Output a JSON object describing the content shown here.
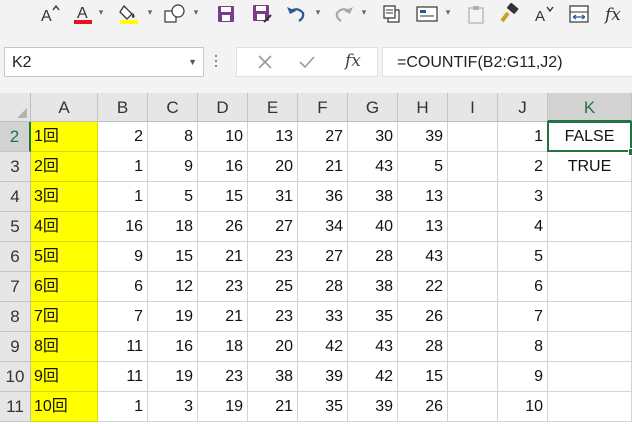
{
  "toolbar": {
    "font_color": "#e81123",
    "highlight_color": "#ffff00",
    "items": [
      {
        "name": "font-size-increase-icon"
      },
      {
        "name": "font-color-icon"
      },
      {
        "name": "fill-color-icon"
      },
      {
        "name": "shapes-icon"
      },
      {
        "name": "save-icon"
      },
      {
        "name": "save-as-icon"
      },
      {
        "name": "undo-icon"
      },
      {
        "name": "redo-icon"
      },
      {
        "name": "copy-icon"
      },
      {
        "name": "form-icon"
      },
      {
        "name": "paste-icon"
      },
      {
        "name": "format-painter-icon"
      },
      {
        "name": "font-size-decrease-icon"
      },
      {
        "name": "column-width-icon"
      },
      {
        "name": "insert-function-icon"
      }
    ]
  },
  "formula_bar": {
    "name_box": "K2",
    "fx_label": "fx",
    "formula": "=COUNTIF(B2:G11,J2)"
  },
  "grid": {
    "accent_color": "#217346",
    "highlight_fill": "#ffff00",
    "selected_cell": "K2",
    "columns": [
      "A",
      "B",
      "C",
      "D",
      "E",
      "F",
      "G",
      "H",
      "I",
      "J",
      "K"
    ],
    "rows": [
      {
        "num": "2",
        "A": "1回",
        "B": "2",
        "C": "8",
        "D": "10",
        "E": "13",
        "F": "27",
        "G": "30",
        "H": "39",
        "I": "",
        "J": "1",
        "K": "FALSE"
      },
      {
        "num": "3",
        "A": "2回",
        "B": "1",
        "C": "9",
        "D": "16",
        "E": "20",
        "F": "21",
        "G": "43",
        "H": "5",
        "I": "",
        "J": "2",
        "K": "TRUE"
      },
      {
        "num": "4",
        "A": "3回",
        "B": "1",
        "C": "5",
        "D": "15",
        "E": "31",
        "F": "36",
        "G": "38",
        "H": "13",
        "I": "",
        "J": "3",
        "K": ""
      },
      {
        "num": "5",
        "A": "4回",
        "B": "16",
        "C": "18",
        "D": "26",
        "E": "27",
        "F": "34",
        "G": "40",
        "H": "13",
        "I": "",
        "J": "4",
        "K": ""
      },
      {
        "num": "6",
        "A": "5回",
        "B": "9",
        "C": "15",
        "D": "21",
        "E": "23",
        "F": "27",
        "G": "28",
        "H": "43",
        "I": "",
        "J": "5",
        "K": ""
      },
      {
        "num": "7",
        "A": "6回",
        "B": "6",
        "C": "12",
        "D": "23",
        "E": "25",
        "F": "28",
        "G": "38",
        "H": "22",
        "I": "",
        "J": "6",
        "K": ""
      },
      {
        "num": "8",
        "A": "7回",
        "B": "7",
        "C": "19",
        "D": "21",
        "E": "23",
        "F": "33",
        "G": "35",
        "H": "26",
        "I": "",
        "J": "7",
        "K": ""
      },
      {
        "num": "9",
        "A": "8回",
        "B": "11",
        "C": "16",
        "D": "18",
        "E": "20",
        "F": "42",
        "G": "43",
        "H": "28",
        "I": "",
        "J": "8",
        "K": ""
      },
      {
        "num": "10",
        "A": "9回",
        "B": "11",
        "C": "19",
        "D": "23",
        "E": "38",
        "F": "39",
        "G": "42",
        "H": "15",
        "I": "",
        "J": "9",
        "K": ""
      },
      {
        "num": "11",
        "A": "10回",
        "B": "1",
        "C": "3",
        "D": "19",
        "E": "21",
        "F": "35",
        "G": "39",
        "H": "26",
        "I": "",
        "J": "10",
        "K": ""
      }
    ]
  }
}
